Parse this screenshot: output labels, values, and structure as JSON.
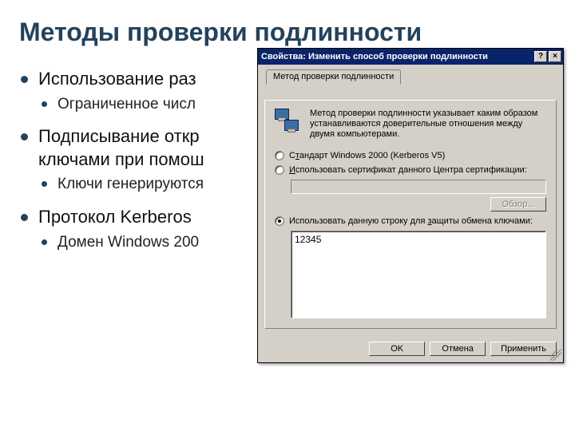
{
  "slide": {
    "title": "Методы проверки подлинности",
    "bullets": [
      {
        "text": "Использование раз",
        "sub": [
          "Ограниченное числ"
        ]
      },
      {
        "text": "Подписывание откр\nключами при помош",
        "sub": [
          "Ключи генерируются"
        ]
      },
      {
        "text": "Протокол Kerberos",
        "sub": [
          "Домен Windows 200"
        ]
      }
    ]
  },
  "dialog": {
    "title": "Свойства: Изменить способ проверки подлинности",
    "help_glyph": "?",
    "close_glyph": "×",
    "tab_label": "Метод проверки подлинности",
    "description": "Метод проверки подлинности указывает каким образом устанавливаются доверительные отношения между двумя компьютерами.",
    "radio1": {
      "pre": "С",
      "u": "т",
      "post": "андарт Windows 2000 (Kerberos V5)"
    },
    "radio2": {
      "pre": "",
      "u": "И",
      "post": "спользовать сертификат данного Центра сертификации:"
    },
    "browse_label": "Обзор...",
    "radio3": {
      "pre": "Использовать данную строку для ",
      "u": "з",
      "post": "ащиты обмена ключами:"
    },
    "key_value": "12345",
    "buttons": {
      "ok": "OK",
      "cancel": "Отмена",
      "apply": "Применить"
    }
  }
}
